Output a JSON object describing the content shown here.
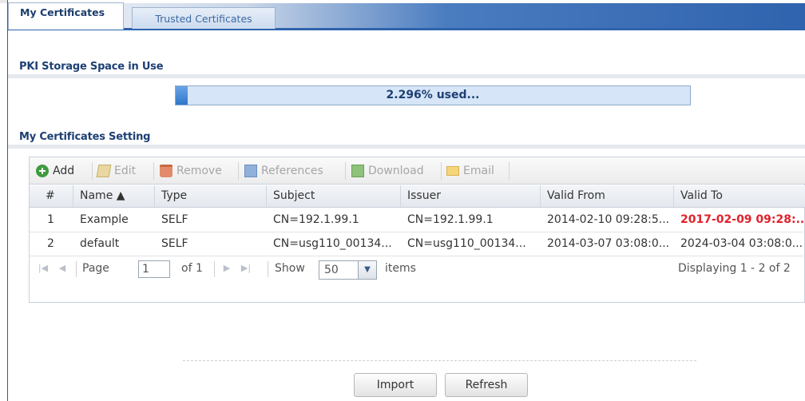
{
  "tabs": [
    {
      "label": "My Certificates",
      "active": true
    },
    {
      "label": "Trusted Certificates",
      "active": false
    }
  ],
  "storage": {
    "title": "PKI Storage Space in Use",
    "percent_used": 2.296,
    "text": "2.296% used..."
  },
  "settings": {
    "title": "My Certificates Setting",
    "toolbar": {
      "add": "Add",
      "edit": "Edit",
      "remove": "Remove",
      "references": "References",
      "download": "Download",
      "email": "Email"
    },
    "columns": {
      "num": "#",
      "name": "Name ▲",
      "type": "Type",
      "subject": "Subject",
      "issuer": "Issuer",
      "valid_from": "Valid From",
      "valid_to": "Valid To"
    },
    "rows": [
      {
        "num": "1",
        "name": "Example",
        "type": "SELF",
        "subject": "CN=192.1.99.1",
        "issuer": "CN=192.1.99.1",
        "valid_from": "2014-02-10 09:28:5...",
        "valid_to": "2017-02-09 09:28:...",
        "expired": true
      },
      {
        "num": "2",
        "name": "default",
        "type": "SELF",
        "subject": "CN=usg110_00134...",
        "issuer": "CN=usg110_00134...",
        "valid_from": "2014-03-07 03:08:0...",
        "valid_to": "2024-03-04 03:08:0...",
        "expired": false
      }
    ],
    "pager": {
      "page_label": "Page",
      "page_value": "1",
      "of_label": "of 1",
      "show_label": "Show",
      "show_value": "50",
      "items_label": "items",
      "displaying": "Displaying 1 - 2 of 2"
    }
  },
  "buttons": {
    "import": "Import",
    "refresh": "Refresh"
  },
  "colors": {
    "expired_text": "#e0212b",
    "tab_bar_dark": "#2f63ad"
  }
}
